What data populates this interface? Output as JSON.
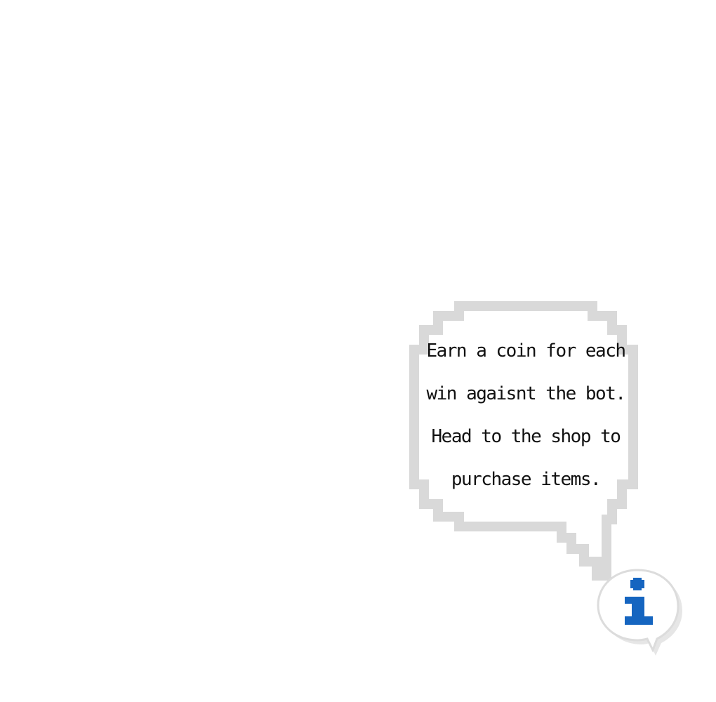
{
  "tooltip": {
    "lines": [
      "Earn a coin for each",
      "win agaisnt the bot.",
      "Head to the shop to",
      "purchase items."
    ]
  },
  "info_button": {
    "icon": "info-icon"
  },
  "colors": {
    "background": "#ffffff",
    "bubble_border": "#d9d9d9",
    "text": "#111111",
    "info_icon": "#1565c0"
  }
}
